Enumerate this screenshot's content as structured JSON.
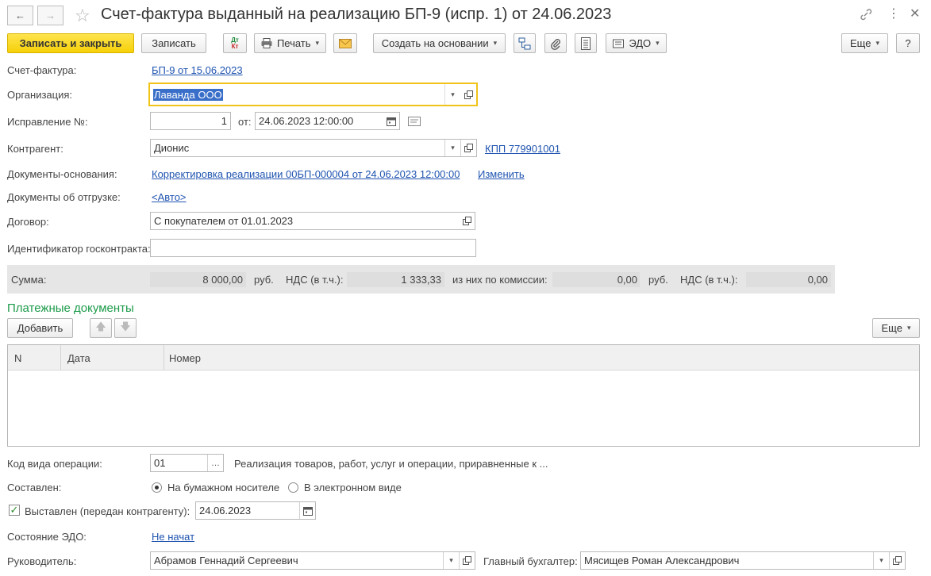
{
  "window": {
    "title": "Счет-фактура выданный на реализацию БП-9 (испр. 1) от 24.06.2023"
  },
  "toolbar": {
    "save_close": "Записать и закрыть",
    "save": "Записать",
    "dtkt_top": "Дт",
    "dtkt_bottom": "Кт",
    "print": "Печать",
    "create_based": "Создать на основании",
    "edo": "ЭДО",
    "more": "Еще",
    "help": "?"
  },
  "form": {
    "invoice_label": "Счет-фактура:",
    "invoice_link": "БП-9 от 15.06.2023",
    "org_label": "Организация:",
    "org_value": "Лаванда ООО",
    "correction_label": "Исправление №:",
    "correction_value": "1",
    "from_label": "от:",
    "from_value": "24.06.2023 12:00:00",
    "counterparty_label": "Контрагент:",
    "counterparty_value": "Дионис",
    "kpp_link": "КПП 779901001",
    "base_docs_label": "Документы-основания:",
    "base_docs_link": "Корректировка реализации 00БП-000004 от 24.06.2023 12:00:00",
    "change_link": "Изменить",
    "shipment_docs_label": "Документы об отгрузке:",
    "shipment_docs_link": "<Авто>",
    "contract_label": "Договор:",
    "contract_value": "С покупателем от 01.01.2023",
    "gov_id_label": "Идентификатор госконтракта:",
    "gov_id_value": ""
  },
  "sums": {
    "sum_label": "Сумма:",
    "sum_value": "8 000,00",
    "currency1": "руб.",
    "vat_label1": "НДС (в т.ч.):",
    "vat_value1": "1 333,33",
    "commission_label": "из них по комиссии:",
    "commission_value": "0,00",
    "currency2": "руб.",
    "vat_label2": "НДС (в т.ч.):",
    "vat_value2": "0,00"
  },
  "payments": {
    "title": "Платежные документы",
    "add": "Добавить",
    "more": "Еще",
    "columns": [
      "N",
      "Дата",
      "Номер"
    ]
  },
  "bottom": {
    "op_code_label": "Код вида операции:",
    "op_code_value": "01",
    "op_code_desc": "Реализация товаров, работ, услуг и операции, приравненные к ...",
    "composed_label": "Составлен:",
    "paper": "На бумажном носителе",
    "electronic": "В электронном виде",
    "issued_label": "Выставлен (передан контрагенту):",
    "issued_date": "24.06.2023",
    "edo_state_label": "Состояние ЭДО:",
    "edo_state_link": "Не начат",
    "head_label": "Руководитель:",
    "head_value": "Абрамов Геннадий Сергеевич",
    "accountant_label": "Главный бухгалтер:",
    "accountant_value": "Мясищев Роман Александрович"
  }
}
